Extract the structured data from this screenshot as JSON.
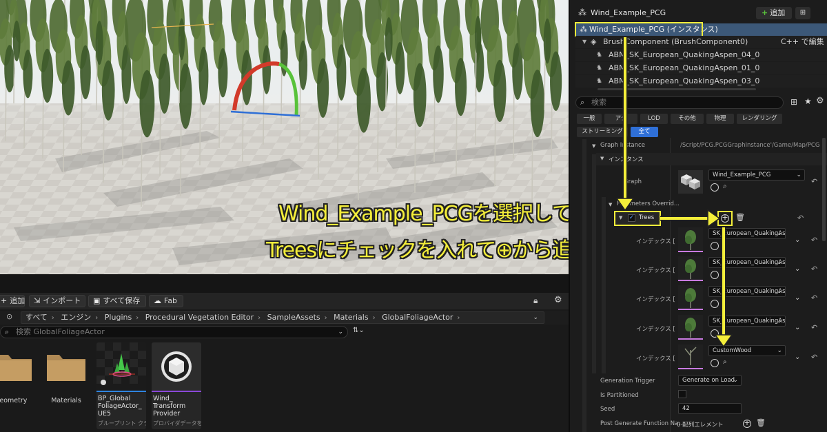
{
  "colors": {
    "annotation": "#f4ee3a",
    "accent": "#2f6fd6",
    "panel": "#1c1c1c",
    "selection": "#3c5878"
  },
  "outliner": {
    "actor_name": "Wind_Example_PCG",
    "add_label": "追加",
    "selected_instance": "Wind_Example_PCG (インスタンス)",
    "components": [
      {
        "label": "BrushComponent (BrushComponent0)",
        "action": "C++ で編集"
      },
      {
        "label": "ABM_SK_European_QuakingAspen_04_0"
      },
      {
        "label": "ABM_SK_European_QuakingAspen_01_0"
      },
      {
        "label": "ABM_SK_European_QuakingAspen_03_0"
      }
    ]
  },
  "details": {
    "search_placeholder": "検索",
    "filters": [
      "一般",
      "アク",
      "LOD",
      "その他",
      "物理",
      "レンダリング",
      "ストリーミング",
      "全て"
    ],
    "graph_instance_label": "Graph Instance",
    "graph_instance_value": "/Script/PCG.PCGGraphInstance'/Game/Map/PCG",
    "instance_section": "インスタンス",
    "graph_label": "Graph",
    "graph_value": "Wind_Example_PCG",
    "parameters_override": "Parameters Overrid...",
    "trees_label": "Trees",
    "index_label": "インデックス [",
    "index_items": [
      "SK_European_QuakingAs",
      "SK_European_QuakingAs",
      "SK_European_QuakingAs",
      "SK_European_QuakingAs",
      "CustomWood"
    ],
    "generation_trigger_label": "Generation Trigger",
    "generation_trigger_value": "Generate on Load",
    "is_partitioned_label": "Is Partitioned",
    "seed_label": "Seed",
    "seed_value": "42",
    "post_generate_label": "Post Generate Function Na...",
    "post_generate_value": "0 配列エレメント"
  },
  "content_browser": {
    "add_label": "追加",
    "import_label": "インポート",
    "save_all_label": "すべて保存",
    "fab_label": "Fab",
    "breadcrumb": [
      "すべて",
      "エンジン",
      "Plugins",
      "Procedural Vegetation Editor",
      "SampleAssets",
      "Materials",
      "GlobalFoliageActor"
    ],
    "search_placeholder": "検索 GlobalFoliageActor",
    "assets": [
      {
        "name": "Geometry"
      },
      {
        "name": "Materials"
      },
      {
        "name": "BP_Global FoliageActor_ UE5",
        "sub": "ブループリント クラス"
      },
      {
        "name": "Wind_ Transform Provider",
        "sub": "プロバイダデータを"
      }
    ]
  },
  "annotation": {
    "line1": "Wind_Example_PCGを選択して、",
    "line2": "Treesにチェックを入れて⊕から追加"
  }
}
